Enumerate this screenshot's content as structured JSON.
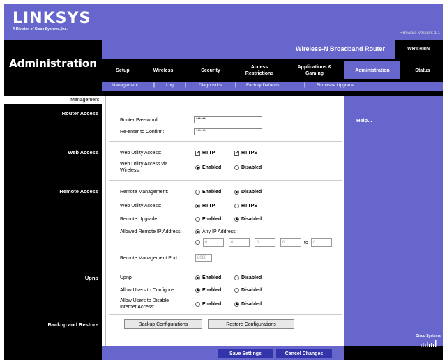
{
  "header": {
    "brand": "LINKSYS",
    "brand_sub": "A Division of Cisco Systems, Inc.",
    "firmware": "Firmware Version: 1.1",
    "product": "Wireless-N Broadband Router",
    "model": "WRT300N",
    "section": "Administration"
  },
  "tabs": [
    {
      "label": "Setup"
    },
    {
      "label": "Wireless"
    },
    {
      "label": "Security"
    },
    {
      "label": "Access Restrictions"
    },
    {
      "label": "Applications & Gaming"
    },
    {
      "label": "Administration"
    },
    {
      "label": "Status"
    }
  ],
  "subtabs": [
    {
      "label": "Management"
    },
    {
      "label": "Log"
    },
    {
      "label": "Diagnostics"
    },
    {
      "label": "Factory Defaults"
    },
    {
      "label": "Firmware Upgrade"
    }
  ],
  "left": {
    "management": "Management",
    "router_access": "Router Access",
    "web_access": "Web Access",
    "remote_access": "Remote Access",
    "upnp": "Upnp",
    "backup": "Backup and Restore"
  },
  "router_access": {
    "password_label": "Router Password:",
    "password_value": "******",
    "confirm_label": "Re-enter to Confirm:",
    "confirm_value": "******"
  },
  "web_access": {
    "utility_label": "Web Utility Access:",
    "http": "HTTP",
    "https": "HTTPS",
    "wireless_label": "Web Utility Access via Wireless:",
    "enabled": "Enabled",
    "disabled": "Disabled"
  },
  "remote_access": {
    "mgmt_label": "Remote Management:",
    "utility_label": "Web Utility Access:",
    "upgrade_label": "Remote Upgrade:",
    "allowed_label": "Allowed Remote IP Address:",
    "any_ip": "Any IP Address",
    "ip_fields": [
      "0",
      "0",
      "0",
      "0",
      "0"
    ],
    "ip_to": "to",
    "port_label": "Remote Management Port:",
    "port_value": "8080",
    "enabled": "Enabled",
    "disabled": "Disabled",
    "http": "HTTP",
    "https": "HTTPS"
  },
  "upnp": {
    "upnp_label": "Upnp:",
    "configure_label": "Allow Users to Configure:",
    "disable_label": "Allow Users to Disable Internet Access:",
    "enabled": "Enabled",
    "disabled": "Disabled"
  },
  "backup": {
    "backup_button": "Backup Configurations",
    "restore_button": "Restore Configurations"
  },
  "help": {
    "link": "Help..."
  },
  "footer": {
    "save": "Save Settings",
    "cancel": "Cancel Changes",
    "cisco": "Cisco Systems"
  },
  "colors": {
    "accent": "#6666cc",
    "button": "#3333aa"
  }
}
